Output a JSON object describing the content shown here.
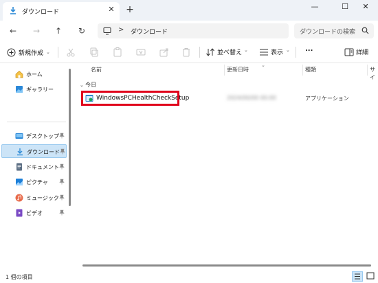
{
  "titlebar": {
    "tab_title": "ダウンロード",
    "tab_close": "✕",
    "new_tab": "+",
    "minimize": "—",
    "maximize": "☐",
    "close": "✕"
  },
  "nav": {
    "back": "←",
    "forward": "→",
    "up": "↑",
    "refresh": "↻",
    "address_sep": ">",
    "crumb": "ダウンロード",
    "search_placeholder": "ダウンロードの検索"
  },
  "toolbar": {
    "new_label": "新規作成",
    "sort_label": "並べ替え",
    "view_label": "表示",
    "more_label": "...",
    "details_label": "詳細"
  },
  "sidebar": {
    "items": [
      {
        "label": "ホーム",
        "icon": "home-icon"
      },
      {
        "label": "ギャラリー",
        "icon": "gallery-icon"
      },
      {
        "label": "デスクトップ",
        "icon": "desktop-icon"
      },
      {
        "label": "ダウンロード",
        "icon": "download-icon",
        "selected": true
      },
      {
        "label": "ドキュメント",
        "icon": "document-icon"
      },
      {
        "label": "ピクチャ",
        "icon": "pictures-icon"
      },
      {
        "label": "ミュージック",
        "icon": "music-icon"
      },
      {
        "label": "ビデオ",
        "icon": "video-icon"
      }
    ]
  },
  "columns": {
    "name": "名前",
    "date": "更新日時",
    "type": "種類",
    "size": "サイ"
  },
  "group": {
    "label": "今日"
  },
  "files": [
    {
      "name": "WindowsPCHealthCheckSetup",
      "date": "2024/00/00 00:00",
      "type": "アプリケーション"
    }
  ],
  "status": {
    "count": "1 個の項目"
  },
  "colors": {
    "accent": "#0067c0",
    "selection": "#cce4f7",
    "highlight_box": "#e0001a"
  }
}
